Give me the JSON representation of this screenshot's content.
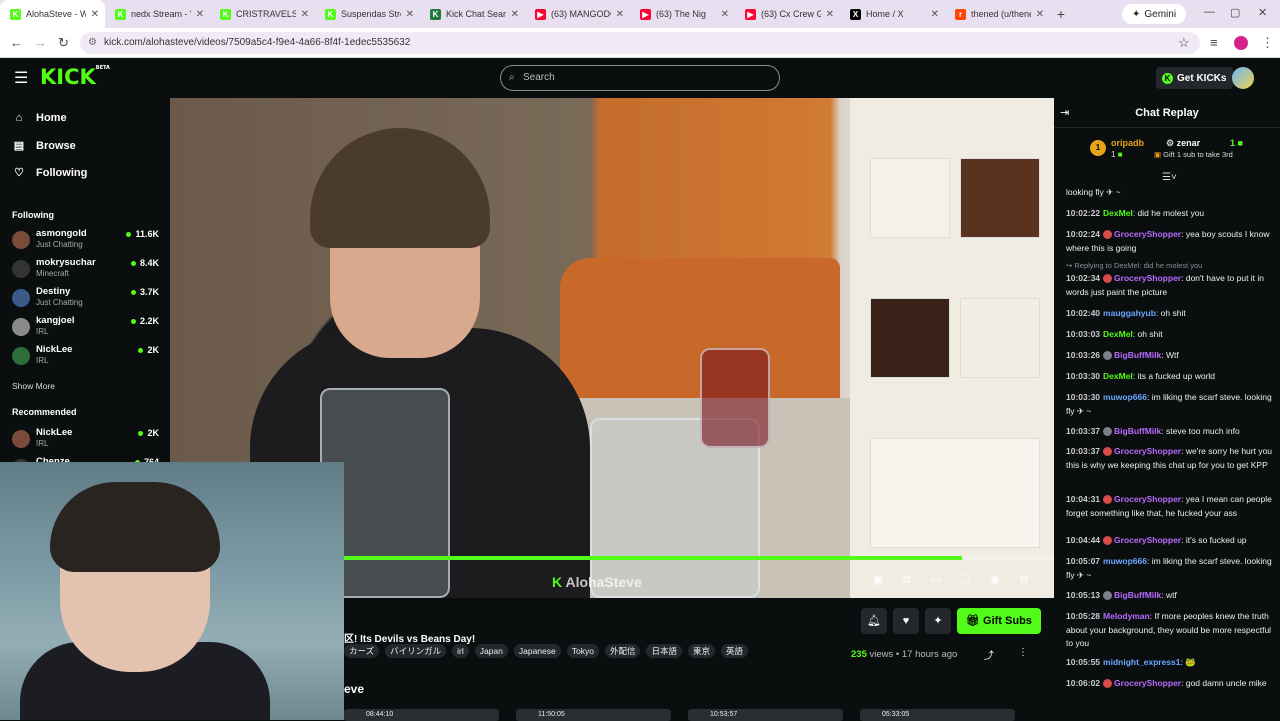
{
  "browser": {
    "tabs": [
      {
        "title": "AlohaSteve - W",
        "fav": "K",
        "color": "#53fc18",
        "active": true
      },
      {
        "title": "nedx Stream - V",
        "fav": "K",
        "color": "#53fc18"
      },
      {
        "title": "CRISTRAVELS St",
        "fav": "K",
        "color": "#53fc18"
      },
      {
        "title": "Suspendas Strea",
        "fav": "K",
        "color": "#53fc18"
      },
      {
        "title": "Kick Chat Search",
        "fav": "K",
        "color": "#1e7a3a"
      },
      {
        "title": "(63) MANGODO",
        "fav": "▶",
        "color": "#ff0033"
      },
      {
        "title": "(63) The Nig",
        "fav": "▶",
        "color": "#ff0033"
      },
      {
        "title": "(63) Cx Crew Go",
        "fav": "▶",
        "color": "#ff0033"
      },
      {
        "title": "Home / X",
        "fav": "X",
        "color": "#000000"
      },
      {
        "title": "thened (u/thene",
        "fav": "r",
        "color": "#ff4500"
      }
    ],
    "new_tab": "+",
    "gemini": "Gemini",
    "url": "kick.com/alohasteve/videos/7509a5c4-f9e4-4a66-8f4f-1edec5535632"
  },
  "header": {
    "logo": "KICK",
    "logo_badge": "BETA",
    "search_placeholder": "Search",
    "get_kicks": "Get KICKs"
  },
  "sidebar": {
    "nav": [
      "Home",
      "Browse",
      "Following"
    ],
    "following_title": "Following",
    "following": [
      {
        "name": "asmongold",
        "category": "Just Chatting",
        "viewers": "11.6K"
      },
      {
        "name": "mokrysuchar",
        "category": "Minecraft",
        "viewers": "8.4K"
      },
      {
        "name": "Destiny",
        "category": "Just Chatting",
        "viewers": "3.7K"
      },
      {
        "name": "kangjoel",
        "category": "IRL",
        "viewers": "2.2K"
      },
      {
        "name": "NickLee",
        "category": "IRL",
        "viewers": "2K"
      }
    ],
    "show_more": "Show More",
    "recommended_title": "Recommended",
    "recommended": [
      {
        "name": "NickLee",
        "category": "IRL",
        "viewers": "2K"
      },
      {
        "name": "Chenze",
        "category": "",
        "viewers": "764"
      }
    ]
  },
  "video": {
    "watermark": "AlohaSteve",
    "progress": 0.87
  },
  "below": {
    "gift_subs": "Gift Subs",
    "title": "区! Its Devils vs Beans Day!",
    "tags": [
      "カーズ",
      "バイリンガル",
      "irl",
      "Japan",
      "Japanese",
      "Tokyo",
      "外配信",
      "日本語",
      "東京",
      "英語"
    ],
    "views_count": "235",
    "views_label": "views",
    "dot": "•",
    "time_ago": "17 hours ago",
    "section": "eve",
    "thumbs": [
      "08:44:10",
      "11:50:05",
      "10:53:57",
      "05:33:05"
    ]
  },
  "chat": {
    "title": "Chat Replay",
    "pinned": {
      "rank": "1",
      "user1": "oripadb",
      "user1_count": "1",
      "user2": "zenar",
      "user2_count": "1",
      "message": "Gift 1 sub to take 3rd"
    },
    "messages": [
      {
        "ts": "",
        "user": "",
        "color": "#ffffff",
        "text": "looking fly ✈ ~",
        "badge": ""
      },
      {
        "ts": "10:02:22",
        "user": "DexMel",
        "color": "#53fc18",
        "text": "did he molest you",
        "badge": ""
      },
      {
        "ts": "10:02:24",
        "user": "GroceryShopper",
        "color": "#b86bff",
        "text": "yea boy scouts I know where this is going",
        "badge": "r"
      },
      {
        "reply": "↪ Replying to DexMel: did he molest you"
      },
      {
        "ts": "10:02:34",
        "user": "GroceryShopper",
        "color": "#b86bff",
        "text": "don't have to put it in words just paint the picture",
        "badge": "r"
      },
      {
        "ts": "10:02:40",
        "user": "mauggahyub",
        "color": "#6aa7ff",
        "text": "oh shit",
        "badge": ""
      },
      {
        "ts": "10:03:03",
        "user": "DexMel",
        "color": "#53fc18",
        "text": "oh shit",
        "badge": ""
      },
      {
        "ts": "10:03:26",
        "user": "BigBuffMilk",
        "color": "#b86bff",
        "text": "Wtf",
        "badge": "g"
      },
      {
        "ts": "10:03:30",
        "user": "DexMel",
        "color": "#53fc18",
        "text": "its a fucked up world",
        "badge": ""
      },
      {
        "ts": "10:03:30",
        "user": "muwop666",
        "color": "#6aa7ff",
        "text": "im liking the scarf steve. looking fly ✈ ~",
        "badge": ""
      },
      {
        "ts": "10:03:37",
        "user": "BigBuffMilk",
        "color": "#b86bff",
        "text": "steve too much info",
        "badge": "g"
      },
      {
        "ts": "10:03:37",
        "user": "GroceryShopper",
        "color": "#b86bff",
        "text": "we're sorry he hurt you this is why we keeping this chat up for you to get KPP",
        "badge": "r"
      },
      {
        "ts": "10:04:31",
        "user": "GroceryShopper",
        "color": "#b86bff",
        "text": "yea I mean can people forget something like that, he fucked your ass",
        "badge": "r"
      },
      {
        "ts": "10:04:44",
        "user": "GroceryShopper",
        "color": "#b86bff",
        "text": "it's so fucked up",
        "badge": "r"
      },
      {
        "ts": "10:05:07",
        "user": "muwop666",
        "color": "#6aa7ff",
        "text": "im liking the scarf steve. looking fly ✈ ~",
        "badge": ""
      },
      {
        "ts": "10:05:13",
        "user": "BigBuffMilk",
        "color": "#b86bff",
        "text": "wtf",
        "badge": "g"
      },
      {
        "ts": "10:05:28",
        "user": "Melodyman",
        "color": "#b86bff",
        "text": "If more peoples knew the truth about your background, they would be more respectful to you",
        "badge": ""
      },
      {
        "ts": "10:05:55",
        "user": "midnight_express1",
        "color": "#6aa7ff",
        "text": "🐸",
        "badge": ""
      },
      {
        "ts": "10:06:02",
        "user": "GroceryShopper",
        "color": "#b86bff",
        "text": "god damn uncle mike",
        "badge": "r"
      }
    ]
  }
}
